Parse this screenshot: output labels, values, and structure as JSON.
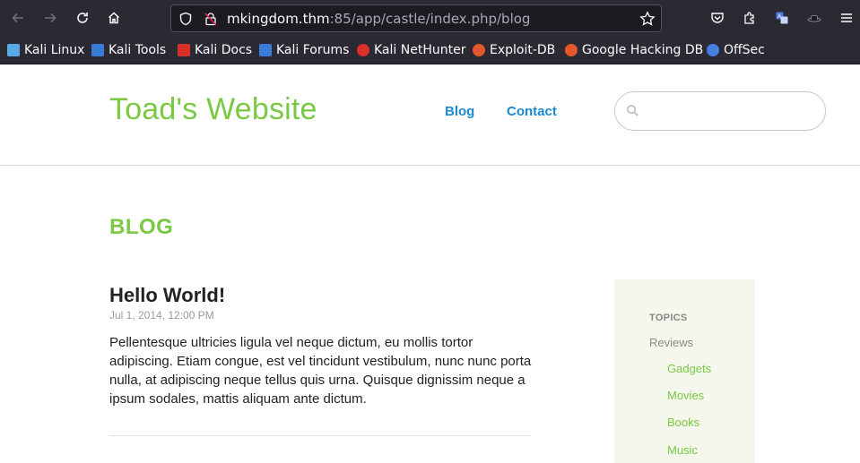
{
  "browser": {
    "url_host": "mkingdom.thm",
    "url_rest": ":85/app/castle/index.php/blog",
    "bookmarks": [
      {
        "label": "Kali Linux",
        "color": "#5aa9e6"
      },
      {
        "label": "Kali Tools",
        "color": "#3b7bd8"
      },
      {
        "label": "Kali Docs",
        "color": "#d9302c"
      },
      {
        "label": "Kali Forums",
        "color": "#3b7bd8"
      },
      {
        "label": "Kali NetHunter",
        "color": "#d9302c"
      },
      {
        "label": "Exploit-DB",
        "color": "#e4562b"
      },
      {
        "label": "Google Hacking DB",
        "color": "#e4562b"
      },
      {
        "label": "OffSec",
        "color": "#4a7de0"
      }
    ]
  },
  "site": {
    "title": "Toad's Website",
    "nav": {
      "blog": "Blog",
      "contact": "Contact"
    },
    "search_placeholder": ""
  },
  "main": {
    "heading": "BLOG",
    "post": {
      "title": "Hello World!",
      "date": "Jul 1, 2014, 12:00 PM",
      "body": "Pellentesque ultricies ligula vel neque dictum, eu mollis tortor adipiscing. Etiam congue, est vel tincidunt vestibulum, nunc nunc porta nulla, at adipiscing neque tellus quis urna. Quisque dignissim neque a ipsum sodales, mattis aliquam ante dictum."
    }
  },
  "sidebar": {
    "heading": "TOPICS",
    "parent": "Reviews",
    "children": [
      "Gadgets",
      "Movies",
      "Books",
      "Music"
    ]
  },
  "colors": {
    "accent": "#7ac943",
    "link": "#1b8ad3",
    "chrome": "#2b2a33"
  }
}
